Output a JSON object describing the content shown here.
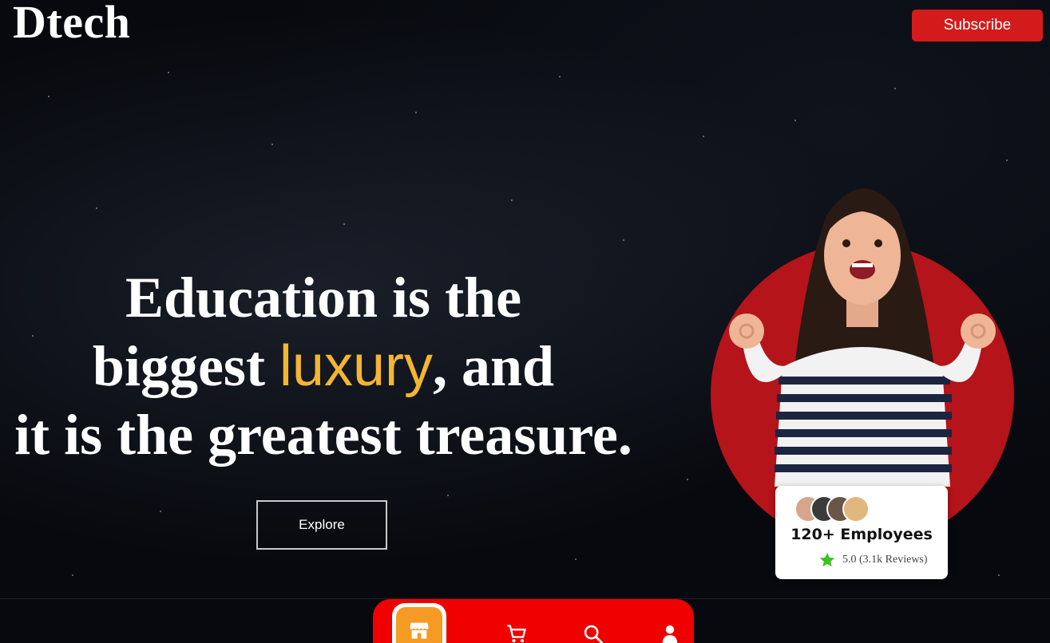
{
  "header": {
    "logo_text": "Dtech",
    "subscribe_label": "Subscribe"
  },
  "hero": {
    "headline_part1": "Education is the",
    "headline_part2_prefix": "biggest ",
    "headline_accent": "luxury",
    "headline_part2_suffix": ", and",
    "headline_part3": "it is the greatest treasure.",
    "explore_label": "Explore"
  },
  "review_card": {
    "employees_label": "120+ Employees",
    "rating_text": "5.0 (3.1k Reviews)"
  },
  "tabbar": {
    "items": [
      {
        "icon": "store-icon",
        "active": true
      },
      {
        "icon": "cart-icon",
        "active": false
      },
      {
        "icon": "search-icon",
        "active": false
      },
      {
        "icon": "user-icon",
        "active": false
      }
    ]
  },
  "colors": {
    "accent": "#f2b632",
    "brand_red": "#d41b1b",
    "tabbar_red": "#f00000",
    "active_tab": "#f59a23",
    "circle_red": "#b4141a"
  }
}
